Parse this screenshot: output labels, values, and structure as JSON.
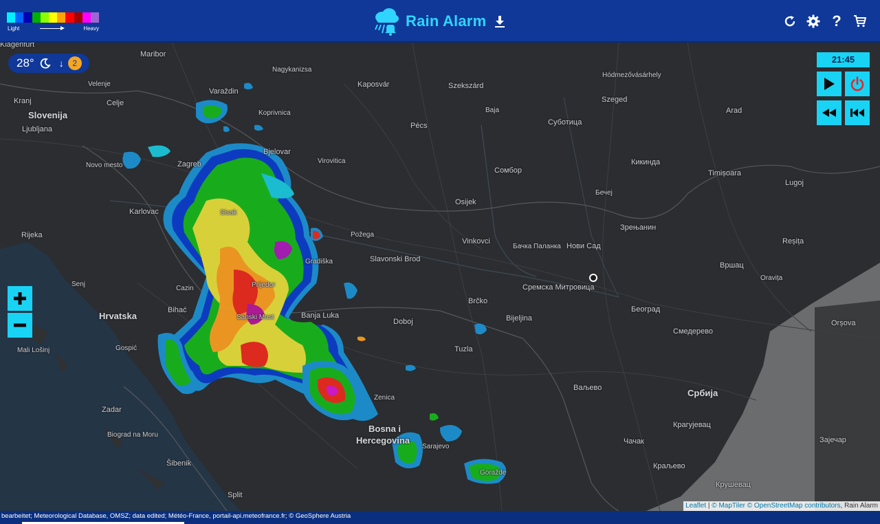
{
  "header": {
    "app_title": "Rain Alarm",
    "legend": {
      "colors": [
        "#00f0ff",
        "#0066ff",
        "#0000b0",
        "#00b000",
        "#8cff00",
        "#ffff00",
        "#ffa500",
        "#ff0000",
        "#a50000",
        "#ff00ff",
        "#9d67d3"
      ],
      "light_label": "Light",
      "heavy_label": "Heavy"
    },
    "actions": {
      "refresh_icon": "refresh-icon",
      "settings_icon": "gear-icon",
      "help_label": "?",
      "shop_icon": "cart-icon"
    }
  },
  "weather": {
    "temperature": "28°",
    "condition_icon": "moon-icon",
    "trend_arrow": "↓",
    "count": "2"
  },
  "player": {
    "time": "21:45",
    "play_icon": "play-icon",
    "power_icon": "power-icon",
    "rewind_icon": "rewind-icon",
    "skip_start_icon": "skip-to-start-icon",
    "power_color": "#e8262b"
  },
  "zoom": {
    "in_icon": "plus-icon",
    "out_icon": "minus-icon"
  },
  "map": {
    "places": [
      {
        "name": "Klagenfurt"
      },
      {
        "name": "Maribor"
      },
      {
        "name": "Nagykanizsa"
      },
      {
        "name": "Hódmezővásárhely"
      },
      {
        "name": "Velenje"
      },
      {
        "name": "Kaposvár"
      },
      {
        "name": "Szekszárd"
      },
      {
        "name": "Varaždin"
      },
      {
        "name": "Kranj"
      },
      {
        "name": "Celje"
      },
      {
        "name": "Szeged"
      },
      {
        "name": "Koprivnica"
      },
      {
        "name": "Baja"
      },
      {
        "name": "Arad"
      },
      {
        "name": "Slovenija"
      },
      {
        "name": "Суботица"
      },
      {
        "name": "Pécs"
      },
      {
        "name": "Ljubljana"
      },
      {
        "name": "Bjelovar"
      },
      {
        "name": "Novo mesto"
      },
      {
        "name": "Zagreb"
      },
      {
        "name": "Virovitica"
      },
      {
        "name": "Кикинда"
      },
      {
        "name": "Сомбор"
      },
      {
        "name": "Timișoara"
      },
      {
        "name": "Lugoj"
      },
      {
        "name": "Бечеј"
      },
      {
        "name": "Osijek"
      },
      {
        "name": "Karlovac"
      },
      {
        "name": "Sisak"
      },
      {
        "name": "Зрењанин"
      },
      {
        "name": "Rijeka"
      },
      {
        "name": "Požega"
      },
      {
        "name": "Vinkovci"
      },
      {
        "name": "Бачка Паланка"
      },
      {
        "name": "Нови Сад"
      },
      {
        "name": "Reșița"
      },
      {
        "name": "Slavonski Brod"
      },
      {
        "name": "Gradiška"
      },
      {
        "name": "Вршац"
      },
      {
        "name": "Oravița"
      },
      {
        "name": "Senj"
      },
      {
        "name": "Prijedor"
      },
      {
        "name": "Сремска Митровица"
      },
      {
        "name": "Cazin"
      },
      {
        "name": "Brčko"
      },
      {
        "name": "Bihać"
      },
      {
        "name": "Београд"
      },
      {
        "name": "Hrvatska"
      },
      {
        "name": "Banja Luka"
      },
      {
        "name": "Sanski Most"
      },
      {
        "name": "Bijeljina"
      },
      {
        "name": "Orșova"
      },
      {
        "name": "Doboj"
      },
      {
        "name": "Смедерево"
      },
      {
        "name": "Mali Lošinj"
      },
      {
        "name": "Gospić"
      },
      {
        "name": "Tuzla"
      },
      {
        "name": "Zenica"
      },
      {
        "name": "Ваљево"
      },
      {
        "name": "Србија"
      },
      {
        "name": "Zadar"
      },
      {
        "name": "Bosna i"
      },
      {
        "name": "Hercegovina"
      },
      {
        "name": "Крагујевац"
      },
      {
        "name": "Biograd na Moru"
      },
      {
        "name": "Sarajevo"
      },
      {
        "name": "Зајечар"
      },
      {
        "name": "Чачак"
      },
      {
        "name": "Šibenik"
      },
      {
        "name": "Goražde"
      },
      {
        "name": "Краљево"
      },
      {
        "name": "Крушевац"
      },
      {
        "name": "Split"
      }
    ],
    "attribution": {
      "leaflet": "Leaflet",
      "separator": " | ",
      "maptiler": "© MapTiler",
      "osm": "© OpenStreetMap contributors",
      "rain_alarm": ", Rain Alarm"
    }
  },
  "footer": {
    "credits": "bearbeitet; Meteorological Database, OMSZ; data edited; Météo-France, portail-api.meteofrance.fr; © GeoSphere Austria"
  }
}
